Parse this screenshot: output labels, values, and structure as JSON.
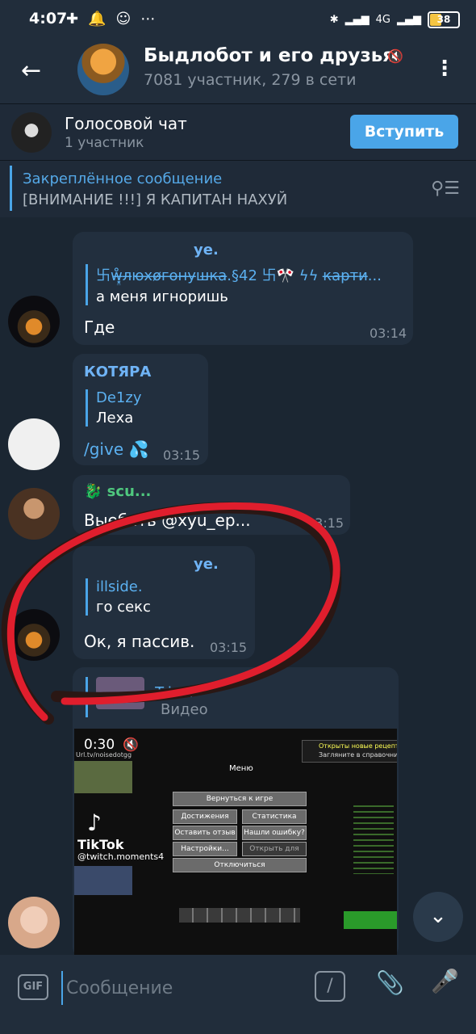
{
  "status": {
    "time": "4:07",
    "battery": "38",
    "network": "4G"
  },
  "header": {
    "title": "Быдлобот и его друзья",
    "subtitle": "7081 участник, 279 в сети"
  },
  "voice_chat": {
    "title": "Голосовой чат",
    "subtitle": "1 участник",
    "join_label": "Вступить"
  },
  "pinned": {
    "title": "Закреплённое сообщение",
    "text": "[ВНИМАНИЕ !!!] Я КАПИТАН НАХУЙ"
  },
  "messages": [
    {
      "author": "ye.",
      "reply_name": "卐ẘ̶͓͚л̶ю̶х̶ø̶г̶о̶н̶у̶ш̶к̶а̶.§42 卐🎌 ϟϟ к̶а̶р̶т̶и̶...",
      "reply_text": "а меня игноришь",
      "text": "Где",
      "time": "03:14"
    },
    {
      "author": "КОТЯРА",
      "reply_name": "De1zy",
      "reply_text": "Леха",
      "text": "/give 💦",
      "time": "03:15"
    },
    {
      "author": "🐉 scu...",
      "text": "Выебать @xyu_ep...",
      "time": "03:15"
    },
    {
      "author": "ye.",
      "reply_name": "illside.",
      "reply_text": "го секс",
      "text": "Ок, я пассив.",
      "time": "03:15"
    },
    {
      "author": "Tric...",
      "reply_text": "Видео"
    }
  ],
  "video": {
    "duration": "0:30",
    "watermark": "TikTok",
    "handle": "@twitch.moments4",
    "url_text": "Url.tv/noisedotgg",
    "notice_1": "Открыты новые рецепты",
    "notice_2": "Загляните в справочник",
    "menu_title": "Меню",
    "buttons": [
      "Вернуться к игре",
      "Достижения",
      "Статистика",
      "Оставить отзыв",
      "Нашли ошибку?",
      "Настройки...",
      "Открыть для сети",
      "Отключиться"
    ]
  },
  "composer": {
    "placeholder": "Сообщение",
    "gif_label": "GIF"
  },
  "icons": [
    "back-arrow-icon",
    "mute-icon",
    "more-vert-icon",
    "unpin-icon",
    "chevron-down-icon",
    "gif-icon",
    "slash-command-icon",
    "attach-icon",
    "mic-icon"
  ],
  "colors": {
    "accent": "#4aa5e8",
    "background": "#1b2632",
    "bubble": "#222f3e",
    "annotation": "#e01e2d"
  }
}
